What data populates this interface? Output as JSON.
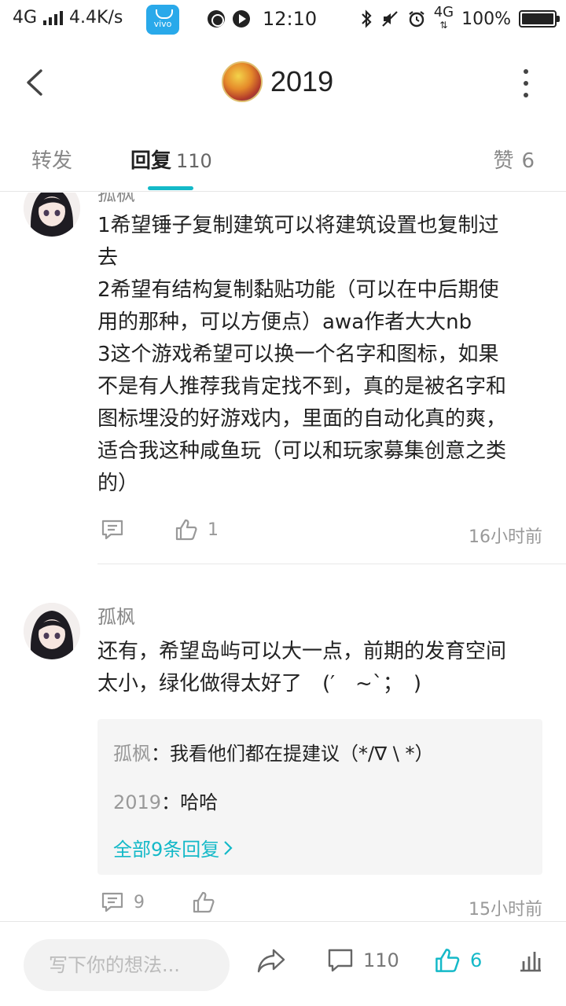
{
  "status_bar": {
    "network": "4G",
    "speed": "4.4K/s",
    "app_icon_label": "vivo",
    "time": "12:10",
    "data_network": "4G",
    "battery": "100%"
  },
  "header": {
    "title": "2019",
    "back_icon": "chevron-left-icon",
    "more_icon": "more-vertical-icon"
  },
  "tabs": {
    "forward_label": "转发",
    "reply_label": "回复",
    "reply_count": "110",
    "like_label": "赞",
    "like_count": "6"
  },
  "comments": [
    {
      "name": "孤枫",
      "text": "1希望锤子复制建筑可以将建筑设置也复制过\n去\n2希望有结构复制黏贴功能（可以在中后期使\n用的那种，可以方便点）awa作者大大nb\n3这个游戏希望可以换一个名字和图标，如果\n不是有人推荐我肯定找不到，真的是被名字和\n图标埋没的好游戏内，里面的自动化真的爽，\n适合我这种咸鱼玩（可以和玩家募集创意之类\n的）",
      "reply_count": "",
      "like_count": "1",
      "time": "16小时前"
    },
    {
      "name": "孤枫",
      "text": "还有，希望岛屿可以大一点，前期的发育空间\n太小，绿化做得太好了　(′　~`；　)",
      "replies": [
        {
          "name": "孤枫",
          "separator": "：",
          "text": "我看他们都在提建议（*/∇ \\ *）"
        },
        {
          "name": "2019",
          "separator": "：",
          "text": "哈哈"
        }
      ],
      "all_replies_label": "全部9条回复",
      "reply_count": "9",
      "like_count": "",
      "time": "15小时前"
    }
  ],
  "bottom_bar": {
    "input_placeholder": "写下你的想法...",
    "comment_count": "110",
    "like_count": "6"
  },
  "colors": {
    "accent": "#14b9c8",
    "text_primary": "#222222",
    "text_secondary": "#999999"
  }
}
